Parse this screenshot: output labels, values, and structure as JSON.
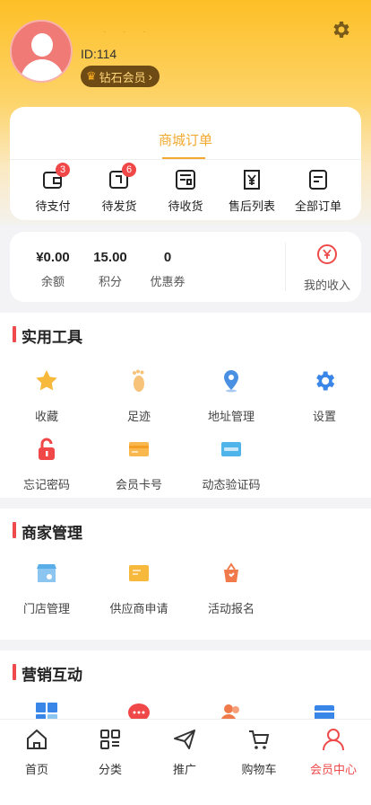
{
  "profile": {
    "user_id": "ID:114",
    "badge_label": "钻石会员"
  },
  "orders": {
    "title": "商城订单",
    "items": [
      {
        "label": "待支付",
        "count": "3"
      },
      {
        "label": "待发货",
        "count": "6"
      },
      {
        "label": "待收货"
      },
      {
        "label": "售后列表"
      },
      {
        "label": "全部订单"
      }
    ]
  },
  "wallet": {
    "stats": [
      {
        "value": "¥0.00",
        "label": "余额"
      },
      {
        "value": "15.00",
        "label": "积分"
      },
      {
        "value": "0",
        "label": "优惠券"
      }
    ],
    "income_label": "我的收入"
  },
  "sections": {
    "tools": {
      "title": "实用工具",
      "items": [
        {
          "label": "收藏",
          "icon": "star-icon",
          "color": "#f6b93b"
        },
        {
          "label": "足迹",
          "icon": "footprint-icon",
          "color": "#f7c27a"
        },
        {
          "label": "地址管理",
          "icon": "location-pin-icon",
          "color": "#4a90e2"
        },
        {
          "label": "设置",
          "icon": "gear-icon",
          "color": "#3a86e8"
        },
        {
          "label": "忘记密码",
          "icon": "lock-icon",
          "color": "#f04848"
        },
        {
          "label": "会员卡号",
          "icon": "card-icon",
          "color": "#f8b84e"
        },
        {
          "label": "动态验证码",
          "icon": "code-card-icon",
          "color": "#4fb4ea"
        }
      ]
    },
    "merchant": {
      "title": "商家管理",
      "items": [
        {
          "label": "门店管理",
          "icon": "store-icon",
          "color": "#5aaee8"
        },
        {
          "label": "供应商申请",
          "icon": "supplier-icon",
          "color": "#f6b93b"
        },
        {
          "label": "活动报名",
          "icon": "event-icon",
          "color": "#f07a4a"
        }
      ]
    },
    "marketing": {
      "title": "营销互动"
    }
  },
  "tabbar": {
    "items": [
      {
        "label": "首页"
      },
      {
        "label": "分类"
      },
      {
        "label": "推广"
      },
      {
        "label": "购物车"
      },
      {
        "label": "会员中心"
      }
    ]
  },
  "colors": {
    "accent": "#f2a92f",
    "active": "#ef4b4b",
    "header": "#fdbf26"
  }
}
